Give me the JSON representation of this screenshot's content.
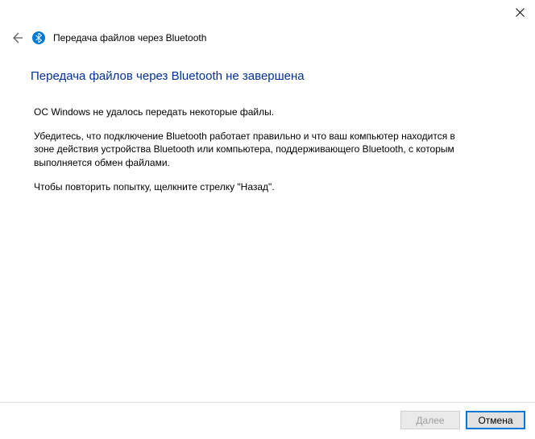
{
  "header": {
    "window_title": "Передача файлов через Bluetooth"
  },
  "content": {
    "heading": "Передача файлов через Bluetooth не завершена",
    "p1": "ОС Windows не удалось передать некоторые файлы.",
    "p2": "Убедитесь, что подключение Bluetooth работает правильно и что ваш компьютер находится в зоне действия устройства Bluetooth или компьютера, поддерживающего Bluetooth, с которым выполняется обмен файлами.",
    "p3": "Чтобы повторить попытку, щелкните стрелку \"Назад\"."
  },
  "footer": {
    "next_label": "Далее",
    "cancel_label": "Отмена"
  }
}
